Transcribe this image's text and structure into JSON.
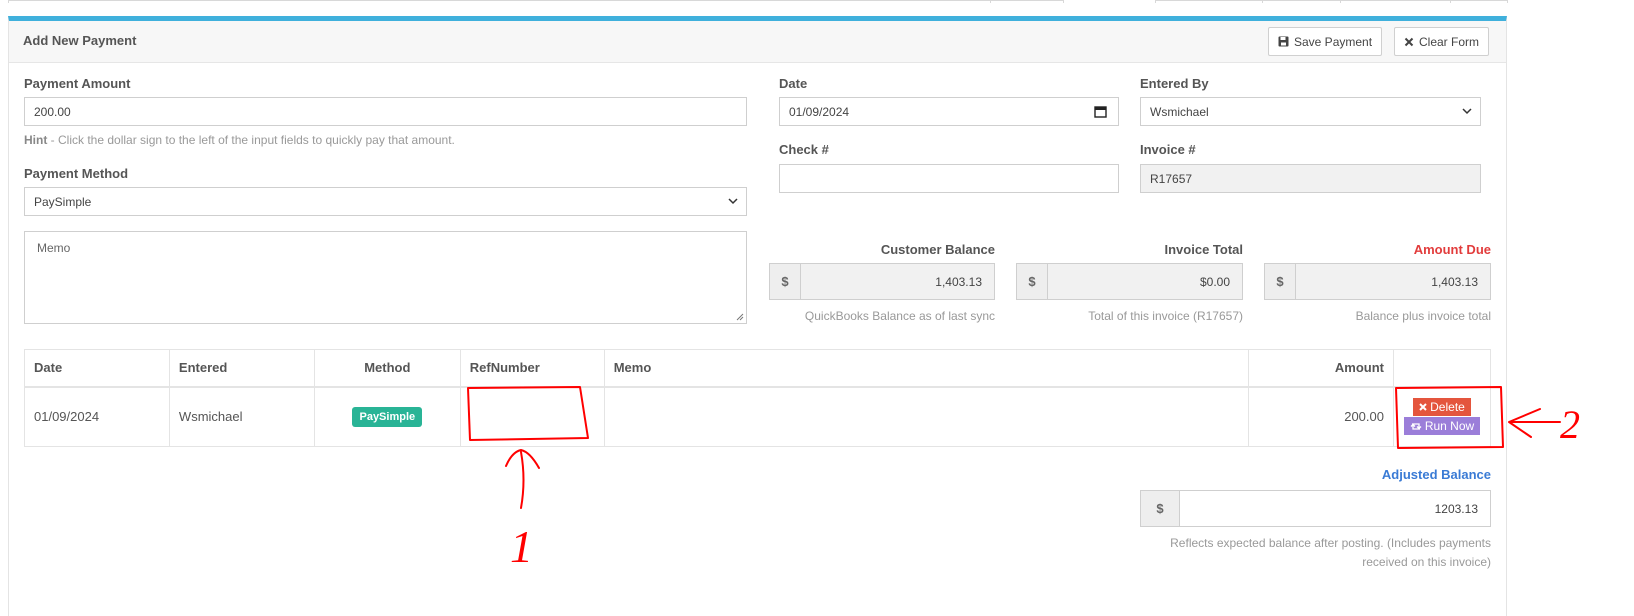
{
  "panel": {
    "title": "Add New Payment",
    "save_label": "Save Payment",
    "clear_label": "Clear Form"
  },
  "form": {
    "payment_amount_label": "Payment Amount",
    "payment_amount_value": "200.00",
    "hint_prefix": "Hint",
    "hint_text": " - Click the dollar sign to the left of the input fields to quickly pay that amount.",
    "payment_method_label": "Payment Method",
    "payment_method_value": "PaySimple",
    "memo_placeholder": "Memo",
    "date_label": "Date",
    "date_value": "01/09/2024",
    "entered_by_label": "Entered By",
    "entered_by_value": "Wsmichael",
    "check_label": "Check #",
    "check_value": "",
    "invoice_label": "Invoice #",
    "invoice_value": "R17657"
  },
  "balances": {
    "currency_symbol": "$",
    "customer_balance_label": "Customer Balance",
    "customer_balance_value": "1,403.13",
    "customer_balance_note": "QuickBooks Balance as of last sync",
    "invoice_total_label": "Invoice Total",
    "invoice_total_value": "$0.00",
    "invoice_total_note": "Total of this invoice (R17657)",
    "amount_due_label": "Amount Due",
    "amount_due_value": "1,403.13",
    "amount_due_note": "Balance plus invoice total",
    "adjusted_label": "Adjusted Balance",
    "adjusted_value": "1203.13",
    "adjusted_note_line1": "Reflects expected balance after posting. (Includes payments",
    "adjusted_note_line2": "received on this invoice)"
  },
  "table": {
    "headers": [
      "Date",
      "Entered",
      "Method",
      "RefNumber",
      "Memo",
      "Amount",
      ""
    ],
    "rows": [
      {
        "date": "01/09/2024",
        "entered": "Wsmichael",
        "method": "PaySimple",
        "refnumber": "",
        "memo": "",
        "amount": "200.00",
        "delete_label": "Delete",
        "run_label": "Run Now"
      }
    ]
  },
  "annotations": {
    "label_1": "1",
    "label_2": "2",
    "color": "#ff0000"
  },
  "colors": {
    "accent": "#3fb0dc",
    "badge": "#29b496",
    "delete": "#e4553d",
    "run": "#9b7ed9",
    "amount_due": "#e23c3c",
    "adjusted": "#3a7bd5"
  }
}
